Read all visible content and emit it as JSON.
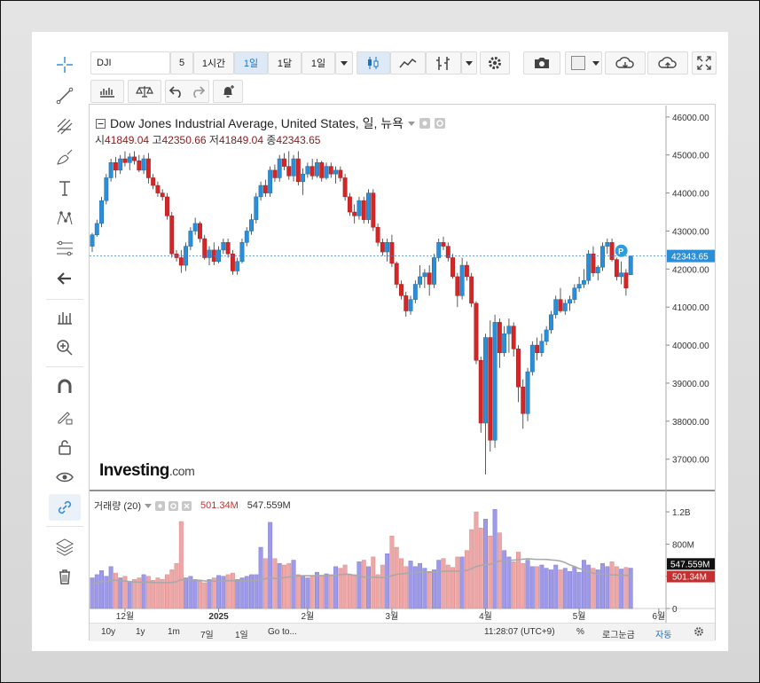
{
  "toolbar": {
    "symbol": "DJI",
    "intervals": [
      "5",
      "1시간",
      "1일",
      "1달",
      "1일"
    ],
    "selected_interval": "1일"
  },
  "chart_header": {
    "title": "Dow Jones Industrial Average, United States, 일, 뉴욕",
    "open_label": "시",
    "open": "41849.04",
    "high_label": "고",
    "high": "42350.66",
    "low_label": "저",
    "low": "41849.04",
    "close_label": "종",
    "close": "42343.65"
  },
  "volume_legend": {
    "label": "거래량 (20)",
    "value1": "501.34M",
    "value2": "547.559M"
  },
  "price_axis": {
    "ticks": [
      "46000.00",
      "45000.00",
      "44000.00",
      "43000.00",
      "42000.00",
      "41000.00",
      "40000.00",
      "39000.00",
      "38000.00",
      "37000.00"
    ],
    "current_price": "42343.65"
  },
  "volume_axis": {
    "ticks": [
      "1.2B",
      "800M",
      "400M",
      "0"
    ],
    "tag_ma": "547.559M",
    "tag_vol": "501.34M"
  },
  "time_axis": {
    "labels": [
      "12월",
      "2025",
      "2월",
      "3월",
      "4월",
      "5월",
      "6월"
    ]
  },
  "bottom_bar": {
    "ranges": [
      "10y",
      "1y",
      "1m",
      "7일",
      "1일"
    ],
    "goto": "Go to...",
    "clock": "11:28:07 (UTC+9)",
    "percent": "%",
    "log": "로그눈금",
    "auto": "자동"
  },
  "logo": {
    "main": "Investing",
    "suffix": ".com"
  },
  "marker_label": "P",
  "colors": {
    "up": "#2a8fd6",
    "down": "#d42626",
    "vol_up": "#9f9ae8",
    "vol_down": "#eda7a7",
    "accent": "#1e73be"
  },
  "chart_data": {
    "type": "candlestick",
    "ohlc": [
      [
        42600,
        42950,
        42450,
        42900
      ],
      [
        42900,
        43300,
        42850,
        43200
      ],
      [
        43200,
        43900,
        43100,
        43800
      ],
      [
        43800,
        44500,
        43700,
        44400
      ],
      [
        44400,
        44900,
        44300,
        44800
      ],
      [
        44800,
        44950,
        44400,
        44600
      ],
      [
        44600,
        45000,
        44500,
        44900
      ],
      [
        44900,
        45100,
        44700,
        44800
      ],
      [
        44800,
        45050,
        44600,
        44950
      ],
      [
        44950,
        45100,
        44750,
        44850
      ],
      [
        44850,
        45000,
        44550,
        44600
      ],
      [
        44600,
        45000,
        44500,
        44900
      ],
      [
        44900,
        45050,
        44250,
        44400
      ],
      [
        44400,
        44500,
        44100,
        44200
      ],
      [
        44200,
        44300,
        43900,
        44000
      ],
      [
        44000,
        44100,
        43800,
        43900
      ],
      [
        43900,
        44000,
        43300,
        43400
      ],
      [
        43400,
        43500,
        42300,
        42400
      ],
      [
        42400,
        42500,
        42200,
        42300
      ],
      [
        42300,
        42500,
        41900,
        42100
      ],
      [
        42100,
        42700,
        41950,
        42600
      ],
      [
        42600,
        43100,
        42500,
        43000
      ],
      [
        43000,
        43350,
        42900,
        43200
      ],
      [
        43200,
        43250,
        42700,
        42800
      ],
      [
        42800,
        42900,
        42250,
        42300
      ],
      [
        42300,
        42600,
        42100,
        42500
      ],
      [
        42500,
        42700,
        42100,
        42200
      ],
      [
        42200,
        42600,
        42150,
        42500
      ],
      [
        42500,
        42800,
        42400,
        42700
      ],
      [
        42700,
        42800,
        42300,
        42400
      ],
      [
        42400,
        42500,
        41850,
        41950
      ],
      [
        41950,
        42300,
        41850,
        42200
      ],
      [
        42200,
        42800,
        42150,
        42700
      ],
      [
        42700,
        43100,
        42600,
        43000
      ],
      [
        43000,
        43450,
        42900,
        43300
      ],
      [
        43300,
        44000,
        43200,
        43900
      ],
      [
        43900,
        44300,
        43800,
        44200
      ],
      [
        44200,
        44350,
        43900,
        44000
      ],
      [
        44000,
        44700,
        43900,
        44600
      ],
      [
        44600,
        44750,
        44300,
        44400
      ],
      [
        44400,
        45000,
        44300,
        44900
      ],
      [
        44900,
        45050,
        44600,
        44700
      ],
      [
        44700,
        45100,
        44350,
        44450
      ],
      [
        44450,
        45000,
        44300,
        44900
      ],
      [
        44900,
        45100,
        44200,
        44300
      ],
      [
        44300,
        44650,
        43950,
        44500
      ],
      [
        44500,
        44800,
        44400,
        44700
      ],
      [
        44700,
        44900,
        44350,
        44450
      ],
      [
        44450,
        44900,
        44400,
        44800
      ],
      [
        44800,
        44850,
        44300,
        44400
      ],
      [
        44400,
        44800,
        44350,
        44700
      ],
      [
        44700,
        44800,
        44400,
        44500
      ],
      [
        44500,
        44700,
        44250,
        44600
      ],
      [
        44600,
        44700,
        44300,
        44400
      ],
      [
        44400,
        44500,
        43800,
        43900
      ],
      [
        43900,
        44000,
        43400,
        43500
      ],
      [
        43500,
        43700,
        43200,
        43400
      ],
      [
        43400,
        43900,
        43300,
        43800
      ],
      [
        43800,
        43900,
        43200,
        43300
      ],
      [
        43300,
        44100,
        43200,
        44000
      ],
      [
        44000,
        44100,
        43000,
        43100
      ],
      [
        43100,
        43200,
        42600,
        42700
      ],
      [
        42700,
        42800,
        42350,
        42450
      ],
      [
        42450,
        42800,
        42200,
        42700
      ],
      [
        42700,
        42900,
        42050,
        42150
      ],
      [
        42150,
        42200,
        41500,
        41600
      ],
      [
        41600,
        41700,
        41200,
        41300
      ],
      [
        41300,
        41400,
        40750,
        40900
      ],
      [
        40900,
        41300,
        40800,
        41200
      ],
      [
        41200,
        41700,
        41100,
        41600
      ],
      [
        41600,
        42100,
        41500,
        41800
      ],
      [
        41800,
        42000,
        41500,
        41900
      ],
      [
        41900,
        42100,
        41300,
        41600
      ],
      [
        41600,
        42400,
        41500,
        42300
      ],
      [
        42300,
        42800,
        42200,
        42700
      ],
      [
        42700,
        42850,
        42500,
        42600
      ],
      [
        42600,
        42700,
        42200,
        42300
      ],
      [
        42300,
        42400,
        41750,
        41800
      ],
      [
        41800,
        41900,
        41000,
        41300
      ],
      [
        41300,
        42300,
        41200,
        42100
      ],
      [
        42100,
        42200,
        41700,
        41800
      ],
      [
        41800,
        41900,
        41000,
        41100
      ],
      [
        41100,
        41150,
        39500,
        39600
      ],
      [
        39600,
        39700,
        37700,
        37950
      ],
      [
        37950,
        40300,
        36600,
        40200
      ],
      [
        40200,
        40650,
        37200,
        37500
      ],
      [
        37500,
        40800,
        37300,
        40600
      ],
      [
        40600,
        40700,
        39400,
        39800
      ],
      [
        39800,
        40500,
        39700,
        40300
      ],
      [
        40300,
        40700,
        39800,
        40500
      ],
      [
        40500,
        40600,
        39700,
        39900
      ],
      [
        39900,
        40000,
        38500,
        38900
      ],
      [
        38900,
        39100,
        37800,
        38200
      ],
      [
        38200,
        39400,
        38000,
        39300
      ],
      [
        39300,
        40100,
        39200,
        40000
      ],
      [
        40000,
        40200,
        39600,
        39800
      ],
      [
        39800,
        40300,
        39700,
        40100
      ],
      [
        40100,
        40500,
        40000,
        40400
      ],
      [
        40400,
        40900,
        40300,
        40800
      ],
      [
        40800,
        41300,
        40700,
        41200
      ],
      [
        41200,
        41500,
        40850,
        40900
      ],
      [
        40900,
        41200,
        40800,
        41100
      ],
      [
        41100,
        41300,
        40900,
        41200
      ],
      [
        41200,
        41600,
        41100,
        41500
      ],
      [
        41500,
        41800,
        41400,
        41600
      ],
      [
        41600,
        42000,
        41500,
        41700
      ],
      [
        41700,
        42500,
        41600,
        42400
      ],
      [
        42400,
        42600,
        41800,
        41900
      ],
      [
        41900,
        42100,
        41700,
        42050
      ],
      [
        42050,
        42700,
        41950,
        42600
      ],
      [
        42600,
        42800,
        42400,
        42700
      ],
      [
        42700,
        42800,
        42200,
        42250
      ],
      [
        42250,
        42300,
        41700,
        41800
      ],
      [
        41800,
        42200,
        41600,
        41900
      ],
      [
        41900,
        42000,
        41300,
        41500
      ],
      [
        41849.04,
        42350.66,
        41849.04,
        42343.65
      ]
    ],
    "volume_M": [
      380,
      420,
      470,
      400,
      520,
      440,
      380,
      400,
      340,
      360,
      380,
      420,
      400,
      350,
      380,
      360,
      420,
      480,
      560,
      1080,
      380,
      400,
      360,
      340,
      320,
      360,
      380,
      410,
      400,
      420,
      440,
      360,
      380,
      400,
      420,
      420,
      760,
      620,
      1070,
      620,
      560,
      540,
      560,
      600,
      420,
      400,
      380,
      400,
      450,
      410,
      430,
      420,
      520,
      500,
      540,
      420,
      420,
      580,
      600,
      520,
      640,
      420,
      540,
      680,
      900,
      760,
      620,
      520,
      590,
      520,
      560,
      500,
      460,
      480,
      600,
      620,
      540,
      510,
      640,
      640,
      720,
      980,
      1200,
      1000,
      1110,
      900,
      1230,
      940,
      720,
      640,
      580,
      700,
      560,
      600,
      520,
      520,
      540,
      500,
      480,
      540,
      480,
      500,
      460,
      520,
      450,
      600,
      540,
      500,
      480,
      560,
      520,
      580,
      520,
      490,
      510,
      501
    ],
    "volume_ma_M": 547.559,
    "time_labels": [
      "12월",
      "2025",
      "2월",
      "3월",
      "4월",
      "5월",
      "6월"
    ],
    "y_range": [
      36200,
      46300
    ],
    "volume_range": [
      0,
      1300
    ]
  }
}
